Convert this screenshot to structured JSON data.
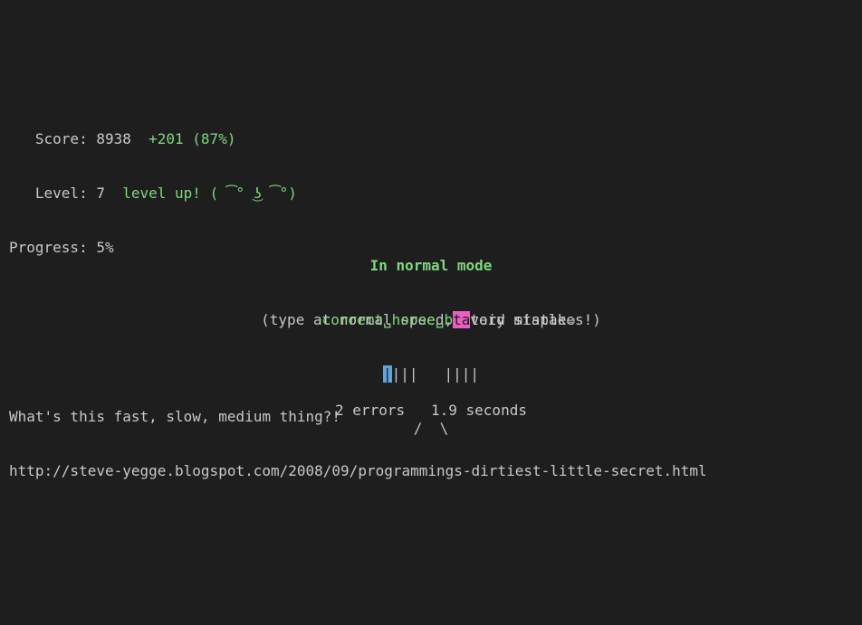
{
  "stats": {
    "score_label": "   Score: ",
    "score_value": "8938",
    "score_delta": "+201 (87%)",
    "level_label": "   Level: ",
    "level_value": "7",
    "level_msg": "level up! ( ͡° ͜ʖ ͡°)",
    "progress_label": "Progress: ",
    "progress_value": "5%"
  },
  "mode": {
    "title": "In normal mode",
    "subtitle": "(type at normal speed, avoid mistakes!)"
  },
  "phrase": {
    "word1": "correct",
    "sep1": "␣",
    "word2": "horse",
    "sep2": "␣",
    "partial_typed": "b",
    "cursor": "ta",
    "remaining": "tery staple",
    "return": "↵"
  },
  "ticks": {
    "cursor": "|",
    "row": "|||   ||||",
    "legs": "/  \\"
  },
  "status": {
    "errors": "2 errors",
    "gap": "   ",
    "seconds": "1.9 seconds"
  },
  "footer": {
    "question": "What's this fast, slow, medium thing?!",
    "url": "http://steve-yegge.blogspot.com/2008/09/programmings-dirtiest-little-secret.html"
  },
  "colors": {
    "bg": "#1e1e1e",
    "fg": "#c8c8c8",
    "green": "#7fd77f",
    "magenta_bg": "#e85fbf",
    "blue_bg": "#5fa4d8"
  }
}
